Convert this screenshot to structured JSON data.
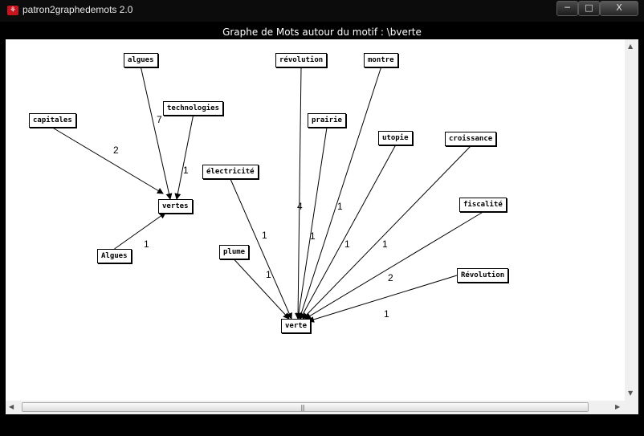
{
  "window": {
    "title": "patron2graphedemots 2.0",
    "app_icon": "app-icon",
    "minimize": "─",
    "maximize": "□",
    "close": "X"
  },
  "canvas": {
    "title": "Graphe de Mots autour du motif : \\bverte"
  },
  "scrollbar": {
    "up": "▲",
    "down": "▼",
    "left": "◀",
    "right": "▶",
    "grip": "|||"
  },
  "graph": {
    "nodes": [
      {
        "id": "algues",
        "label": "algues"
      },
      {
        "id": "technologies",
        "label": "technologies"
      },
      {
        "id": "capitales",
        "label": "capitales"
      },
      {
        "id": "vertes",
        "label": "vertes"
      },
      {
        "id": "Algues",
        "label": "Algues"
      },
      {
        "id": "revolution",
        "label": "révolution"
      },
      {
        "id": "montre",
        "label": "montre"
      },
      {
        "id": "prairie",
        "label": "prairie"
      },
      {
        "id": "utopie",
        "label": "utopie"
      },
      {
        "id": "croissance",
        "label": "croissance"
      },
      {
        "id": "electricite",
        "label": "électricité"
      },
      {
        "id": "fiscalite",
        "label": "fiscalité"
      },
      {
        "id": "plume",
        "label": "plume"
      },
      {
        "id": "Revolution",
        "label": "Révolution"
      },
      {
        "id": "verte",
        "label": "verte"
      }
    ],
    "edges": [
      {
        "from": "algues",
        "to": "vertes",
        "weight": "7"
      },
      {
        "from": "technologies",
        "to": "vertes",
        "weight": "1"
      },
      {
        "from": "capitales",
        "to": "vertes",
        "weight": "2"
      },
      {
        "from": "Algues",
        "to": "vertes",
        "weight": "1"
      },
      {
        "from": "revolution",
        "to": "verte",
        "weight": "4"
      },
      {
        "from": "montre",
        "to": "verte",
        "weight": "1"
      },
      {
        "from": "prairie",
        "to": "verte",
        "weight": "1"
      },
      {
        "from": "utopie",
        "to": "verte",
        "weight": "1"
      },
      {
        "from": "croissance",
        "to": "verte",
        "weight": "1"
      },
      {
        "from": "electricite",
        "to": "verte",
        "weight": "1"
      },
      {
        "from": "fiscalite",
        "to": "verte",
        "weight": "2"
      },
      {
        "from": "plume",
        "to": "verte",
        "weight": "1"
      },
      {
        "from": "Revolution",
        "to": "verte",
        "weight": "1"
      }
    ]
  }
}
